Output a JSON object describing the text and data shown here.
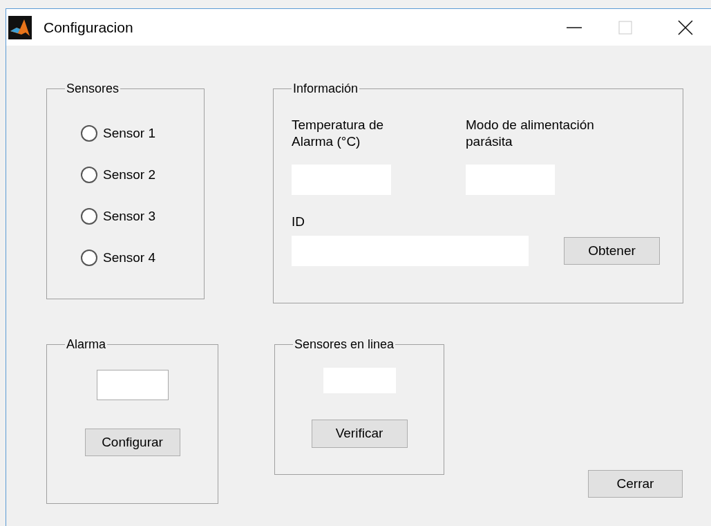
{
  "window": {
    "title": "Configuracion"
  },
  "sensores": {
    "title": "Sensores",
    "options": [
      {
        "label": "Sensor 1",
        "selected": false
      },
      {
        "label": "Sensor 2",
        "selected": false
      },
      {
        "label": "Sensor 3",
        "selected": false
      },
      {
        "label": "Sensor 4",
        "selected": false
      }
    ]
  },
  "informacion": {
    "title": "Información",
    "temperatura_label": "Temperatura de Alarma (°C)",
    "modo_label": "Modo de alimentación parásita",
    "id_label": "ID",
    "button": "Obtener"
  },
  "alarma": {
    "title": "Alarma",
    "button": "Configurar"
  },
  "en_linea": {
    "title": "Sensores en linea",
    "button": "Verificar"
  },
  "close_button": "Cerrar"
}
